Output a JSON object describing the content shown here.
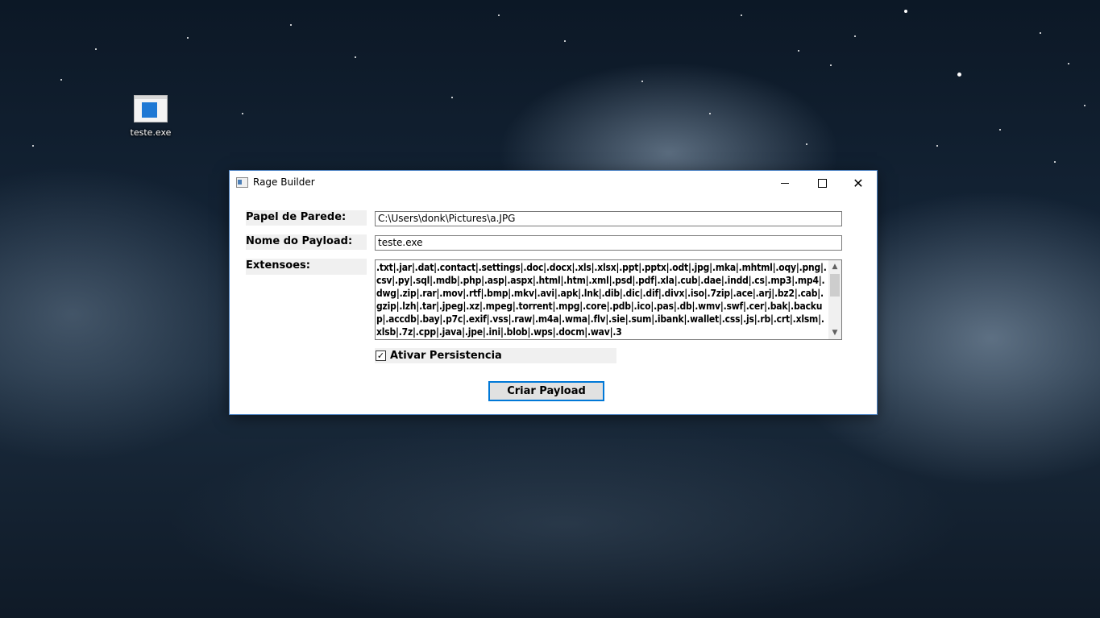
{
  "desktop": {
    "icon_label": "teste.exe"
  },
  "window": {
    "title": "Rage Builder",
    "minimize": "—",
    "close": "✕"
  },
  "form": {
    "wallpaper_label": "Papel de Parede:",
    "wallpaper_value": "C:\\Users\\donk\\Pictures\\a.JPG",
    "payload_name_label": "Nome do Payload:",
    "payload_name_value": "teste.exe",
    "extensions_label": "Extensoes:",
    "extensions_value": ".txt|.jar|.dat|.contact|.settings|.doc|.docx|.xls|.xlsx|.ppt|.pptx|.odt|.jpg|.mka|.mhtml|.oqy|.png|.csv|.py|.sql|.mdb|.php|.asp|.aspx|.html|.htm|.xml|.psd|.pdf|.xla|.cub|.dae|.indd|.cs|.mp3|.mp4|.dwg|.zip|.rar|.mov|.rtf|.bmp|.mkv|.avi|.apk|.lnk|.dib|.dic|.dif|.divx|.iso|.7zip|.ace|.arj|.bz2|.cab|.gzip|.lzh|.tar|.jpeg|.xz|.mpeg|.torrent|.mpg|.core|.pdb|.ico|.pas|.db|.wmv|.swf|.cer|.bak|.backup|.accdb|.bay|.p7c|.exif|.vss|.raw|.m4a|.wma|.flv|.sie|.sum|.ibank|.wallet|.css|.js|.rb|.crt|.xlsm|.xlsb|.7z|.cpp|.java|.jpe|.ini|.blob|.wps|.docm|.wav|.3",
    "persistence_label": "Ativar Persistencia",
    "persistence_checked": true,
    "submit_label": "Criar Payload"
  }
}
